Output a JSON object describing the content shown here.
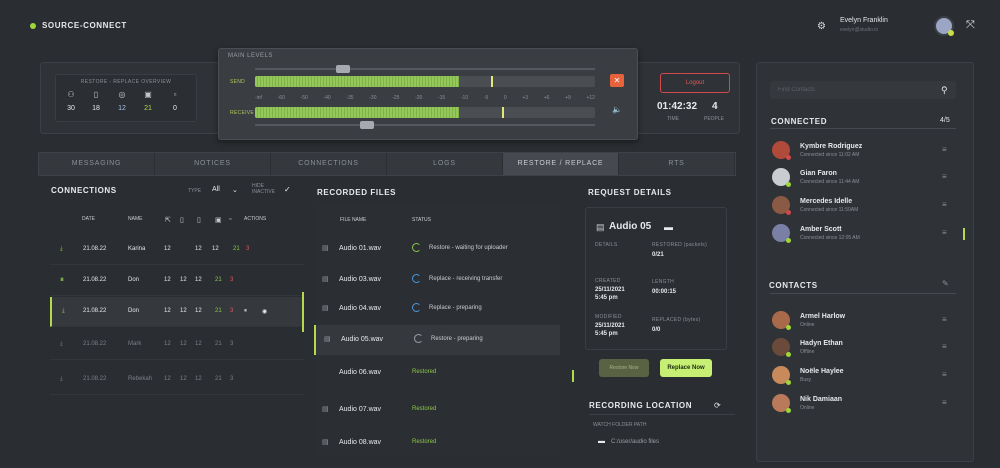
{
  "app": {
    "brand": "SOURCE-CONNECT"
  },
  "user": {
    "name": "Evelyn Franklin",
    "subtitle": "evelyn@studio.io"
  },
  "overview": {
    "title": "RESTORE - REPLACE OVERVIEW",
    "stats": [
      {
        "icon": "network-icon",
        "value": "30"
      },
      {
        "icon": "download-icon",
        "value": "18"
      },
      {
        "icon": "target-icon",
        "value": "12"
      },
      {
        "icon": "transfer-icon",
        "value": "21"
      },
      {
        "icon": "upload-icon",
        "value": "0"
      }
    ]
  },
  "levels": {
    "title": "MAIN LEVELS",
    "send_label": "SEND",
    "receive_label": "RECEIVE",
    "scale": [
      "-inf",
      "-60",
      "-50",
      "-40",
      "-35",
      "-30",
      "-25",
      "-20",
      "-15",
      "-10",
      "-5",
      "0",
      "+3",
      "+6",
      "+9",
      "+12"
    ],
    "send_fill": 0.6,
    "receive_fill": 0.6
  },
  "session": {
    "login_label": "Logout",
    "time": "01:42:32",
    "time_label": "TIME",
    "people": "4",
    "people_label": "PEOPLE"
  },
  "tabs": [
    "MESSAGING",
    "NOTICES",
    "CONNECTIONS",
    "LOGS",
    "RESTORE / REPLACE",
    "RTS"
  ],
  "connections": {
    "title": "CONNECTIONS",
    "type_label": "TYPE",
    "type_value": "All",
    "hide_label": "HIDE INACTIVE",
    "headers": {
      "date": "DATE",
      "name": "NAME",
      "actions": "ACTIONS"
    },
    "rows": [
      {
        "date": "21.08.22",
        "name": "Karina",
        "a": "12",
        "b": "12",
        "c": "12",
        "d": "21",
        "e": "3"
      },
      {
        "date": "21.08.22",
        "name": "Don",
        "a": "12",
        "b": "12",
        "c": "12",
        "d": "21",
        "e": "3"
      },
      {
        "date": "21.08.22",
        "name": "Don",
        "a": "12",
        "b": "12",
        "c": "12",
        "d": "21",
        "e": "3"
      },
      {
        "date": "21.08.22",
        "name": "Mark",
        "a": "12",
        "b": "12",
        "c": "12",
        "d": "21",
        "e": "3"
      },
      {
        "date": "21.08.22",
        "name": "Rebekah",
        "a": "12",
        "b": "12",
        "c": "12",
        "d": "21",
        "e": "3"
      }
    ]
  },
  "files": {
    "title": "RECORDED FILES",
    "headers": {
      "name": "FILE NAME",
      "status": "STATUS"
    },
    "rows": [
      {
        "name": "Audio 01.wav",
        "status": "Restore - waiting for uploader"
      },
      {
        "name": "Audio 03.wav",
        "status": "Replace - receiving transfer"
      },
      {
        "name": "Audio 04.wav",
        "status": "Replace - preparing"
      },
      {
        "name": "Audio 05.wav",
        "status": "Restore - preparing"
      },
      {
        "name": "Audio 06.wav",
        "status": "Restored"
      },
      {
        "name": "Audio 07.wav",
        "status": "Restored"
      },
      {
        "name": "Audio 08.wav",
        "status": "Restored"
      }
    ]
  },
  "request": {
    "title": "REQUEST DETAILS",
    "name": "Audio 05",
    "details_label": "DETAILS",
    "restored_label": "RESTORED (packets)",
    "restored_value": "0/21",
    "created_label": "CREATED",
    "created_value": "25/11/2021",
    "created_time": "5:45 pm",
    "length_label": "LENGTH",
    "length_value": "00:00:15",
    "modified_label": "MODIFIED",
    "modified_value": "25/11/2021",
    "modified_time": "5:45 pm",
    "replaced_label": "REPLACED (bytes)",
    "replaced_value": "0/0",
    "restore_button": "Restore Now",
    "replace_button": "Replace Now"
  },
  "location": {
    "title": "RECORDING LOCATION",
    "folder_label": "WATCH FOLDER PATH",
    "path": "C:/user/audio files"
  },
  "right": {
    "search_placeholder": "Find Contacts",
    "connected_title": "CONNECTED",
    "connected_count": "4/5",
    "connected": [
      {
        "name": "Kymbre Rodriguez",
        "sub": "Connected since 11:02 AM",
        "color": "#b04a3a",
        "dot": "#d04a4a"
      },
      {
        "name": "Gian Faron",
        "sub": "Connected since 11:44 AM",
        "color": "#c9ccd1",
        "dot": "#9ed63c"
      },
      {
        "name": "Mercedes Idelle",
        "sub": "Connected since 11:50AM",
        "color": "#8a5a44",
        "dot": "#d04a4a"
      },
      {
        "name": "Amber Scott",
        "sub": "Connected since 12:05 AM",
        "color": "#7a7fa6",
        "dot": "#9ed63c"
      }
    ],
    "contacts_title": "CONTACTS",
    "contacts": [
      {
        "name": "Armel Harlow",
        "sub": "Online",
        "color": "#a86a4a",
        "dot": "#9ed63c"
      },
      {
        "name": "Hadyn Ethan",
        "sub": "Offline",
        "color": "#6a4a3a",
        "dot": "#9ed63c"
      },
      {
        "name": "Noële Haylee",
        "sub": "Busy",
        "color": "#c88a5a",
        "dot": "#9ed63c"
      },
      {
        "name": "Nik Damiaan",
        "sub": "Online",
        "color": "#b87a5a",
        "dot": "#9ed63c"
      }
    ]
  }
}
